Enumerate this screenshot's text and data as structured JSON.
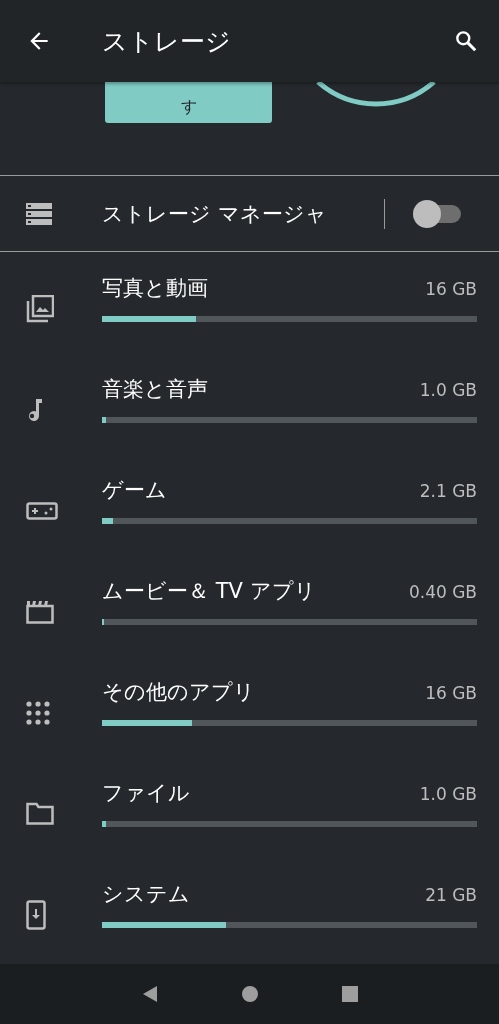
{
  "app_bar": {
    "title": "ストレージ"
  },
  "free_up_button": {
    "label": "す"
  },
  "storage_manager": {
    "label": "ストレージ マネージャ",
    "on": false
  },
  "categories": [
    {
      "kind": "photos",
      "name": "写真と動画",
      "size": "16 GB",
      "level": 0.25
    },
    {
      "kind": "music",
      "name": "音楽と音声",
      "size": "1.0 GB",
      "level": 0.01
    },
    {
      "kind": "games",
      "name": "ゲーム",
      "size": "2.1 GB",
      "level": 0.03
    },
    {
      "kind": "movies",
      "name": "ムービー＆ TV アプリ",
      "size": "0.40 GB",
      "level": 0.005
    },
    {
      "kind": "apps",
      "name": "その他のアプリ",
      "size": "16 GB",
      "level": 0.24
    },
    {
      "kind": "files",
      "name": "ファイル",
      "size": "1.0 GB",
      "level": 0.01
    },
    {
      "kind": "system",
      "name": "システム",
      "size": "21 GB",
      "level": 0.33
    }
  ]
}
